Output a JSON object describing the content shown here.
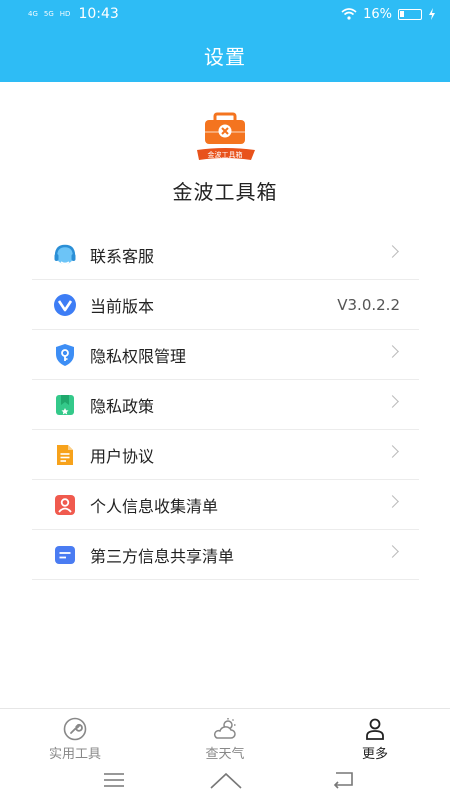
{
  "status_bar": {
    "signal_1": "4G",
    "signal_2": "5G",
    "hd": "HD",
    "time": "10:43",
    "battery": "16%"
  },
  "header": {
    "title": "设置"
  },
  "app": {
    "logo_text": "金波工具箱",
    "name": "金波工具箱"
  },
  "menu": [
    {
      "label": "联系客服",
      "icon": "headset-icon"
    },
    {
      "label": "当前版本",
      "icon": "version-icon",
      "value": "V3.0.2.2"
    },
    {
      "label": "隐私权限管理",
      "icon": "shield-icon"
    },
    {
      "label": "隐私政策",
      "icon": "bookmark-icon"
    },
    {
      "label": "用户协议",
      "icon": "document-icon"
    },
    {
      "label": "个人信息收集清单",
      "icon": "person-card-icon"
    },
    {
      "label": "第三方信息共享清单",
      "icon": "list-icon"
    }
  ],
  "bottom_nav": [
    {
      "label": "实用工具",
      "icon": "wrench-icon",
      "active": false
    },
    {
      "label": "查天气",
      "icon": "weather-icon",
      "active": false
    },
    {
      "label": "更多",
      "icon": "person-icon",
      "active": true
    }
  ],
  "colors": {
    "accent": "#2ebcf5",
    "logo_orange": "#f4741f",
    "divider": "#ececec"
  }
}
